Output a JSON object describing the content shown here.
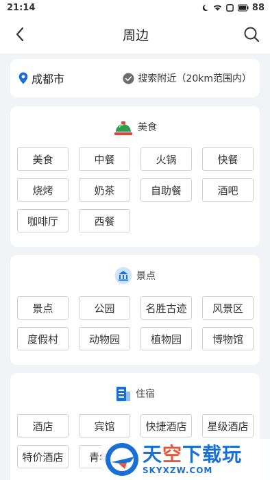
{
  "status": {
    "time": "21:14",
    "battery": "88"
  },
  "nav": {
    "title": "周边"
  },
  "location": {
    "city": "成都市",
    "hint": "搜索附近（20km范围内）"
  },
  "sections": {
    "food": {
      "title": "美食",
      "items": [
        "美食",
        "中餐",
        "火锅",
        "快餐",
        "烧烤",
        "奶茶",
        "自助餐",
        "酒吧",
        "咖啡厅",
        "西餐"
      ]
    },
    "scenic": {
      "title": "景点",
      "items": [
        "景点",
        "公园",
        "名胜古迹",
        "风景区",
        "度假村",
        "动物园",
        "植物园",
        "博物馆"
      ]
    },
    "lodging": {
      "title": "住宿",
      "items": [
        "酒店",
        "宾馆",
        "快捷酒店",
        "星级酒店",
        "特价酒店",
        "青年旅"
      ]
    }
  },
  "watermark": {
    "line1a": "天",
    "line1b": "空",
    "line1c": "下载玩",
    "line2": "SKYXZW.COM"
  },
  "colors": {
    "accent": "#1a6fd6",
    "background": "#f2f3f7"
  }
}
